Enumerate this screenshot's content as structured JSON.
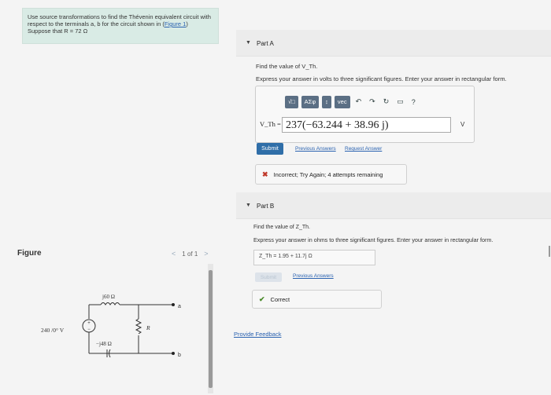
{
  "problem": {
    "line1": "Use source transformations to find the Thévenin equivalent circuit with",
    "line2_pre": "respect to the terminals a, b for the circuit shown in (",
    "line2_link": "Figure 1",
    "line2_post": ")",
    "line3": "Suppose that R = 72 Ω"
  },
  "figure": {
    "label": "Figure",
    "nav_text": "1 of 1",
    "prev": "<",
    "next": ">",
    "circuit": {
      "source": "240 /0° V",
      "inductor": "j60 Ω",
      "capacitor": "−j48 Ω",
      "resistor": "R",
      "terminal_a": "a",
      "terminal_b": "b",
      "plus": "+",
      "minus": "−"
    }
  },
  "part_a": {
    "title": "Part A",
    "prompt": "Find the value of V_Th.",
    "instructions": "Express your answer in volts to three significant figures. Enter your answer in rectangular form.",
    "toolbar": [
      "√□",
      "ΑΣφ",
      "↕",
      "vec",
      "↶",
      "↷",
      "↻",
      "▭",
      "?"
    ],
    "input_label": "V_Th =",
    "input_value": "237(−63.244 + 38.96 j)",
    "unit": "V",
    "submit": "Submit",
    "previous_answers": "Previous Answers",
    "request_answer": "Request Answer",
    "feedback_icon": "✖",
    "feedback": "Incorrect; Try Again; 4 attempts remaining"
  },
  "part_b": {
    "title": "Part B",
    "prompt": "Find the value of Z_Th.",
    "instructions": "Express your answer in ohms to three significant figures. Enter your answer in rectangular form.",
    "input_label": "Z_Th =",
    "input_value": "1.95 + 11.7j Ω",
    "submit": "Submit",
    "previous_answers": "Previous Answers",
    "feedback_icon": "✔",
    "feedback": "Correct"
  },
  "provide_feedback": "Provide Feedback",
  "colors": {
    "problem_bg": "#d9ebe5",
    "link": "#2a62b0",
    "submit": "#2f6ea8",
    "incorrect": "#c0392b",
    "correct": "#4a8a2a"
  }
}
